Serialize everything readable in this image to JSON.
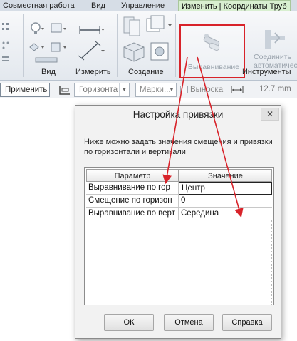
{
  "ribbon": {
    "tabs": [
      "Совместная работа",
      "Вид",
      "Управление",
      "Изменить | Координаты Труб"
    ],
    "panels": [
      "Вид",
      "Измерить",
      "Создание",
      "Инструменты"
    ],
    "align_button": "Выравнивание",
    "connect_button_line1": "Соединить",
    "connect_button_line2": "автоматически"
  },
  "optionsbar": {
    "apply": "Применить",
    "horizontal": "Горизонта",
    "marker": "Марки...",
    "leader": "Выноска",
    "length": "12.7 mm"
  },
  "dialog": {
    "title": "Настройка привязки",
    "close": "✕",
    "description": "Ниже можно задать значения смещения и привязки по горизонтали и вертикали",
    "columns": [
      "Параметр",
      "Значение"
    ],
    "rows": [
      {
        "param": "Выравнивание по гор",
        "value": "Центр"
      },
      {
        "param": "Смещение по горизон",
        "value": "0"
      },
      {
        "param": "Выравнивание по верт",
        "value": "Середина"
      }
    ],
    "buttons": {
      "ok": "ОК",
      "cancel": "Отмена",
      "help": "Справка"
    }
  },
  "colors": {
    "accent_red": "#d8232a",
    "active_tab": "#d8efd0"
  }
}
